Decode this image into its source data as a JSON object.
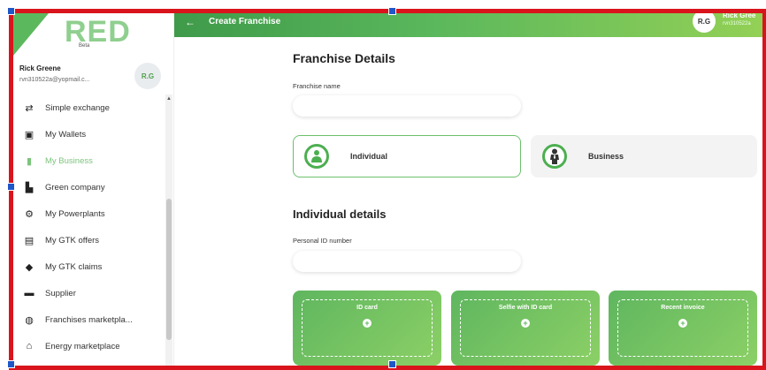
{
  "sidebar": {
    "logo_text": "RED",
    "logo_sub": "Beta",
    "user_name": "Rick Greene",
    "user_email": "rvn310522a@yopmail.c...",
    "avatar_initials": "R.G",
    "items": [
      {
        "label": "Simple exchange",
        "icon": "exchange-icon",
        "glyph": "⇄",
        "active": false
      },
      {
        "label": "My Wallets",
        "icon": "wallet-icon",
        "glyph": "▣",
        "active": false
      },
      {
        "label": "My Business",
        "icon": "business-icon",
        "glyph": "▮",
        "active": true
      },
      {
        "label": "Green company",
        "icon": "company-icon",
        "glyph": "▙",
        "active": false
      },
      {
        "label": "My Powerplants",
        "icon": "powerplant-icon",
        "glyph": "⚙",
        "active": false
      },
      {
        "label": "My GTK offers",
        "icon": "offers-icon",
        "glyph": "▤",
        "active": false
      },
      {
        "label": "My GTK claims",
        "icon": "claims-icon",
        "glyph": "◆",
        "active": false
      },
      {
        "label": "Supplier",
        "icon": "truck-icon",
        "glyph": "▬",
        "active": false
      },
      {
        "label": "Franchises marketpla...",
        "icon": "globe-icon",
        "glyph": "◍",
        "active": false
      },
      {
        "label": "Energy marketplace",
        "icon": "basket-icon",
        "glyph": "⌂",
        "active": false
      }
    ]
  },
  "header": {
    "back_icon": "arrow-left-icon",
    "title": "Create Franchise",
    "avatar_initials": "R.G",
    "user_name": "Rick Gree",
    "user_email": "rvn310522a"
  },
  "main": {
    "franchise_details_title": "Franchise Details",
    "franchise_name_label": "Franchise name",
    "franchise_name_value": "",
    "types": [
      {
        "label": "Individual",
        "icon": "person-icon",
        "selected": true
      },
      {
        "label": "Business",
        "icon": "businessman-icon",
        "selected": false
      }
    ],
    "individual_details_title": "Individual details",
    "personal_id_label": "Personal ID number",
    "personal_id_value": "",
    "uploads": [
      {
        "label": "ID card"
      },
      {
        "label": "Selfie with ID card"
      },
      {
        "label": "Recent invoice"
      }
    ]
  },
  "colors": {
    "accent": "#5cb85c",
    "selection_frame": "#d9141c",
    "handles": "#1f56c8"
  }
}
